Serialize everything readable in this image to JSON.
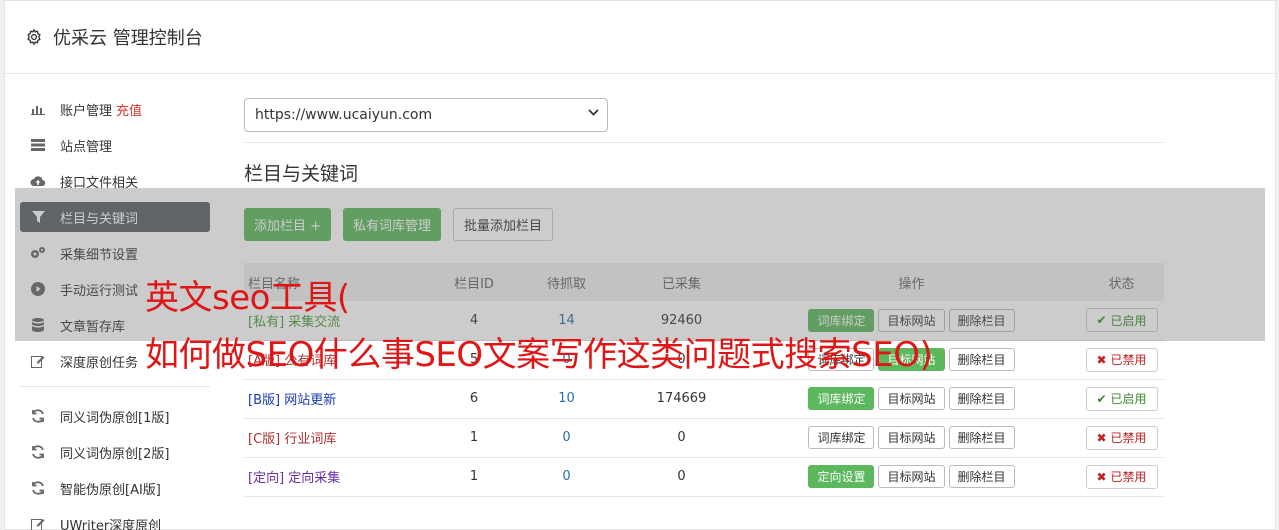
{
  "header": {
    "title": "优采云 管理控制台",
    "icon": "gear-icon"
  },
  "sidebar": {
    "items": [
      {
        "label": "账户管理",
        "extra": "充值",
        "icon": "bar-chart-icon"
      },
      {
        "label": "站点管理",
        "icon": "server-icon"
      },
      {
        "label": "接口文件相关",
        "icon": "cloud-upload-icon"
      },
      {
        "label": "栏目与关键词",
        "icon": "filter-icon",
        "active": true
      },
      {
        "label": "采集细节设置",
        "icon": "cogs-icon"
      },
      {
        "label": "手动运行测试",
        "icon": "play-circle-icon"
      },
      {
        "label": "文章暂存库",
        "icon": "database-icon"
      },
      {
        "label": "深度原创任务",
        "icon": "edit-icon"
      }
    ],
    "items2": [
      {
        "label": "同义词伪原创[1版]",
        "icon": "refresh-icon"
      },
      {
        "label": "同义词伪原创[2版]",
        "icon": "refresh-icon"
      },
      {
        "label": "智能伪原创[AI版]",
        "icon": "refresh-icon"
      },
      {
        "label": "UWriter深度原创",
        "icon": "edit-icon"
      }
    ]
  },
  "site_select": {
    "value": "https://www.ucaiyun.com"
  },
  "section": {
    "title": "栏目与关键词"
  },
  "toolbar": {
    "add": "添加栏目 +",
    "private_lib": "私有词库管理",
    "batch_add": "批量添加栏目"
  },
  "table": {
    "headers": [
      "栏目名称",
      "栏目ID",
      "待抓取",
      "已采集",
      "操作",
      "状态"
    ],
    "rows": [
      {
        "tag": "[私有]",
        "name": "采集交流",
        "id": "4",
        "pending": "14",
        "collected": "92460",
        "op1": "词库绑定",
        "op2": "目标网站",
        "op3": "删除栏目",
        "status": "已启用"
      },
      {
        "tag": "[A版]",
        "name": "公有词库",
        "id": "5",
        "pending": "0",
        "collected": "0",
        "op1": "词库绑定",
        "op2": "目标网站",
        "op3": "删除栏目",
        "status": "已禁用"
      },
      {
        "tag": "[B版]",
        "name": "网站更新",
        "id": "6",
        "pending": "10",
        "collected": "174669",
        "op1": "词库绑定",
        "op2": "目标网站",
        "op3": "删除栏目",
        "status": "已启用"
      },
      {
        "tag": "[C版]",
        "name": "行业词库",
        "id": "1",
        "pending": "0",
        "collected": "0",
        "op1": "词库绑定",
        "op2": "目标网站",
        "op3": "删除栏目",
        "status": "已禁用"
      },
      {
        "tag": "[定向]",
        "name": "定向采集",
        "id": "1",
        "pending": "0",
        "collected": "0",
        "op1": "定向设置",
        "op2": "目标网站",
        "op3": "删除栏目",
        "status": "已禁用"
      }
    ]
  },
  "watermark": {
    "line1": "英文seo工具(",
    "line2": "如何做SEO什么事SEO文案写作这类问题式搜索SEO)"
  }
}
